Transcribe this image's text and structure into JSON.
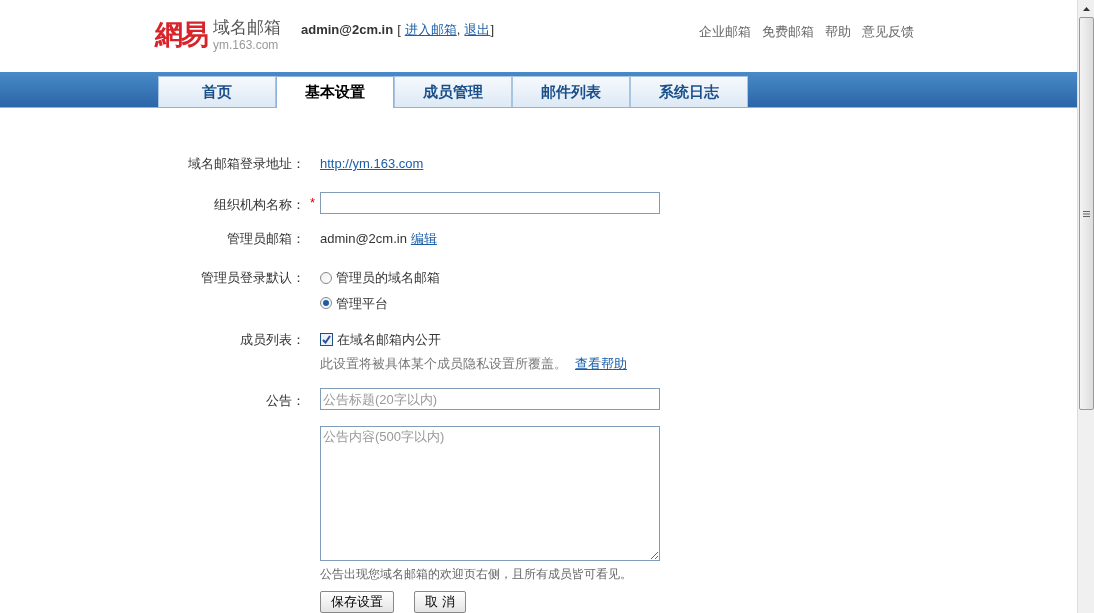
{
  "header": {
    "logo_mark": "網易",
    "logo_title": "域名邮箱",
    "logo_domain": "ym.163.com",
    "user": "admin@2cm.in",
    "bracket_open": "[",
    "user_links": [
      "进入邮箱",
      "退出"
    ],
    "link_separator": ",",
    "bracket_close": "]",
    "top_links": [
      "企业邮箱",
      "免费邮箱",
      "帮助",
      "意见反馈"
    ]
  },
  "tabs": [
    {
      "label": "首页",
      "selected": false
    },
    {
      "label": "基本设置",
      "selected": true
    },
    {
      "label": "成员管理",
      "selected": false
    },
    {
      "label": "邮件列表",
      "selected": false
    },
    {
      "label": "系统日志",
      "selected": false
    }
  ],
  "form": {
    "login_url": {
      "label": "域名邮箱登录地址：",
      "value": "http://ym.163.com"
    },
    "org_name": {
      "label": "组织机构名称：",
      "required_mark": "*"
    },
    "admin_email": {
      "label": "管理员邮箱：",
      "value": "admin@2cm.in",
      "link": "编辑"
    },
    "admin_login": {
      "label": "管理员登录默认：",
      "options": [
        {
          "label": "管理员的域名邮箱",
          "selected": false
        },
        {
          "label": "管理平台",
          "selected": true
        }
      ]
    },
    "member_list": {
      "label": "成员列表：",
      "checkbox": {
        "label": "在域名邮箱内公开",
        "checked": true
      },
      "note": "此设置将被具体某个成员隐私设置所覆盖。",
      "help_link": "查看帮助"
    },
    "notice": {
      "label": "公告：",
      "title_placeholder": "公告标题(20字以内)",
      "content_placeholder": "公告内容(500字以内)",
      "hint": "公告出现您域名邮箱的欢迎页右侧，且所有成员皆可看见。"
    },
    "buttons": [
      "保存设置",
      "取 消"
    ]
  }
}
